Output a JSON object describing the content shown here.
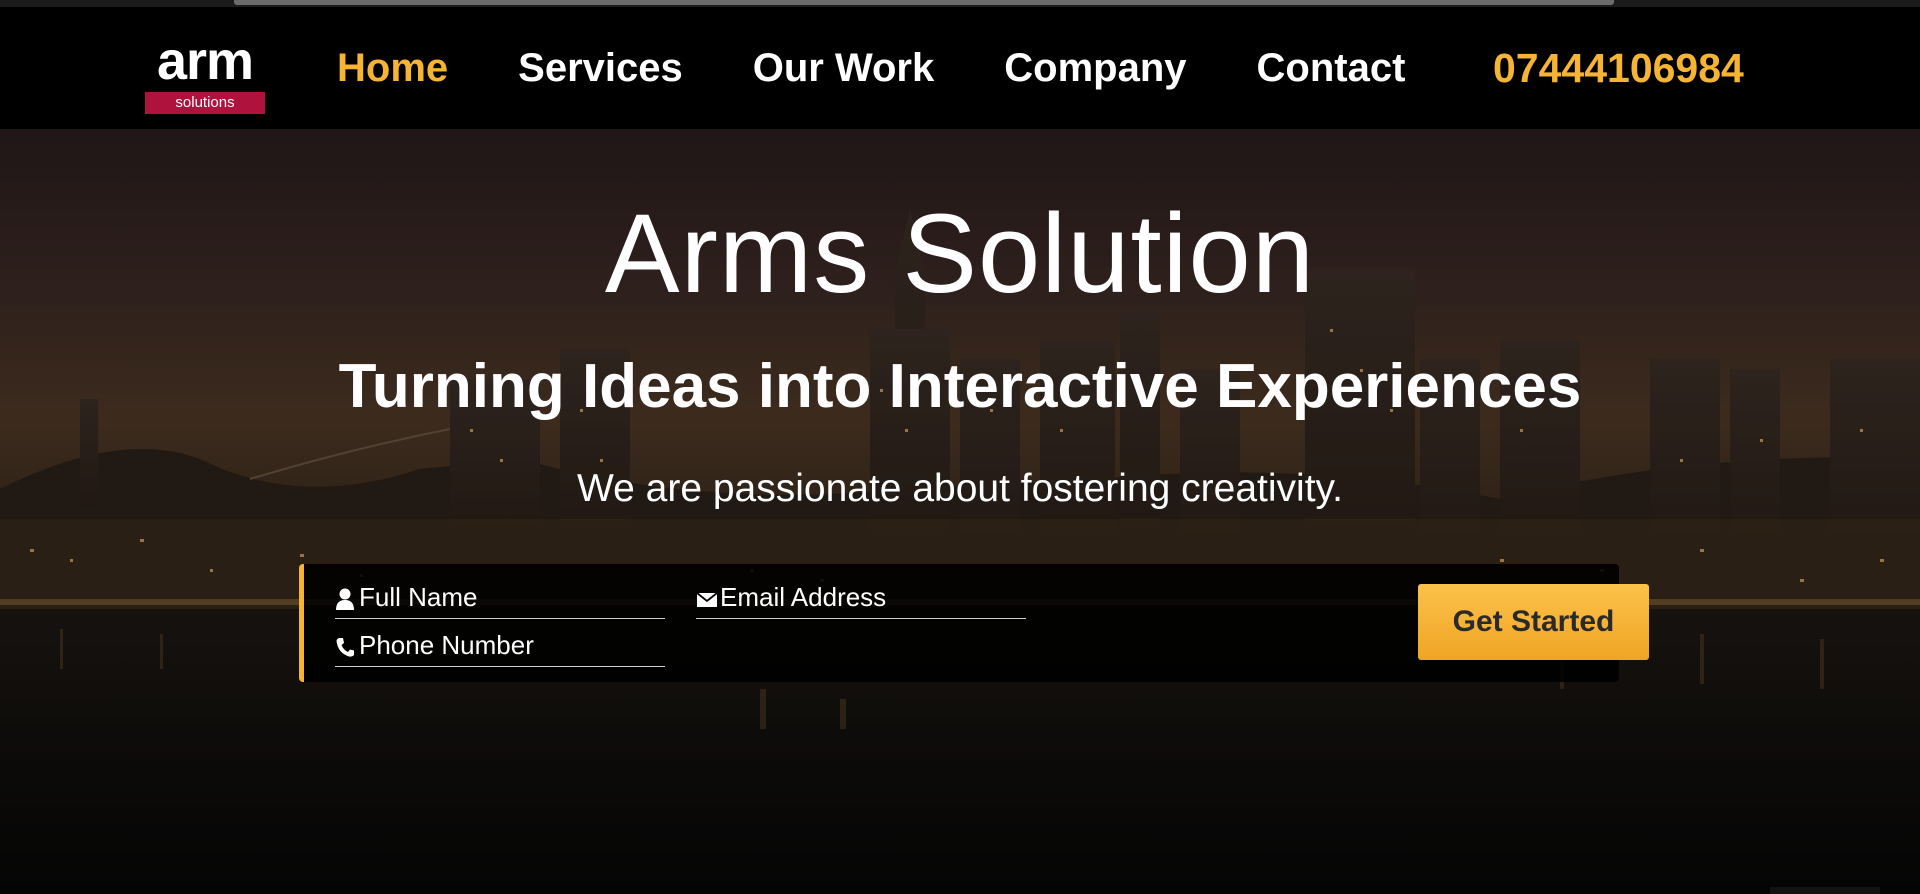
{
  "logo": {
    "word": "arm",
    "tagline": "solutions"
  },
  "nav": {
    "items": [
      {
        "label": "Home"
      },
      {
        "label": "Services"
      },
      {
        "label": "Our Work"
      },
      {
        "label": "Company"
      },
      {
        "label": "Contact"
      }
    ],
    "phone": "07444106984"
  },
  "hero": {
    "title": "Arms Solution",
    "subtitle": "Turning Ideas into Interactive Experiences",
    "tagline": "We are passionate about fostering creativity."
  },
  "form": {
    "full_name_placeholder": "Full Name",
    "email_placeholder": "Email Address",
    "phone_placeholder": "Phone Number",
    "submit_label": "Get Started"
  },
  "colors": {
    "accent": "#f6b434",
    "logo_tag_bg": "#b0123e",
    "header_bg": "#000000",
    "button_text": "#2a2a2a"
  },
  "icons": {
    "name_field": "user-icon",
    "email_field": "envelope-icon",
    "phone_field": "phone-icon"
  }
}
